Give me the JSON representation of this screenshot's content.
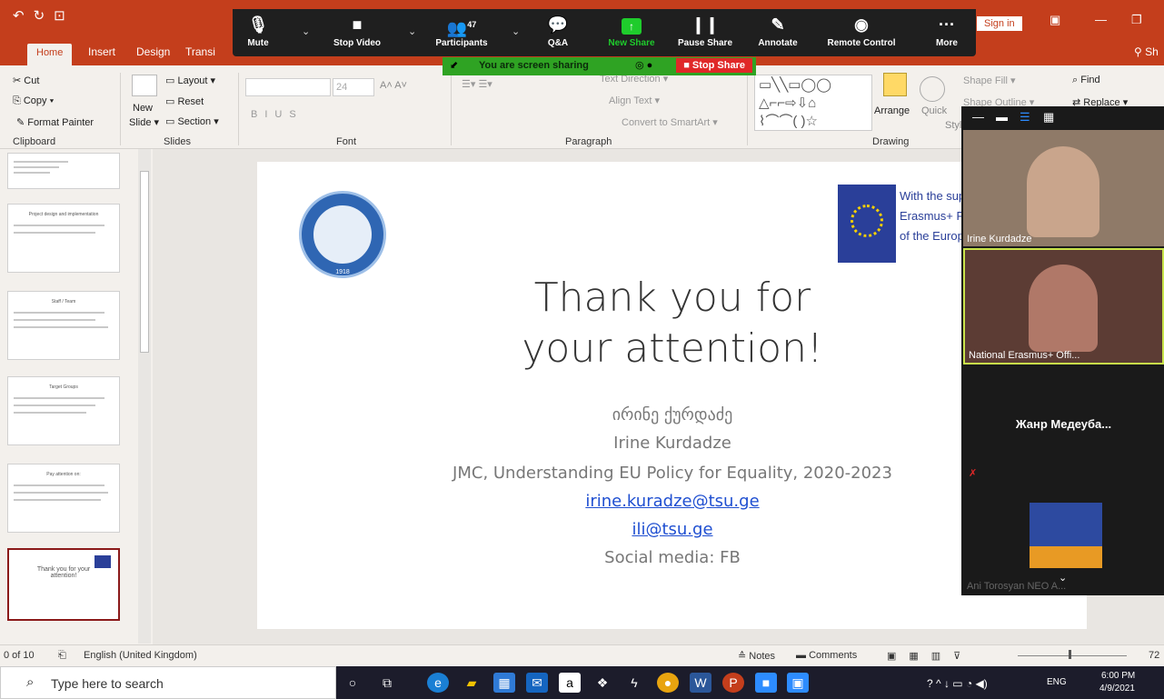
{
  "ribbon_tabs": [
    "Home",
    "Insert",
    "Design",
    "Transi"
  ],
  "title": {
    "sign_in": "Sign in",
    "share": "Sh"
  },
  "zoom_toolbar": {
    "mute": "Mute",
    "stop_video": "Stop Video",
    "participants": "Participants",
    "participants_count": "47",
    "qa": "Q&A",
    "new_share": "New Share",
    "pause_share": "Pause Share",
    "annotate": "Annotate",
    "remote_control": "Remote Control",
    "more": "More"
  },
  "share_bar": {
    "status": "You are screen sharing",
    "stop": "Stop Share"
  },
  "clipboard": {
    "cut": "Cut",
    "copy": "Copy",
    "format_painter": "Format Painter",
    "group": "Clipboard"
  },
  "slides_group": {
    "new_slide": "New",
    "new_slide2": "Slide",
    "layout": "Layout",
    "reset": "Reset",
    "section": "Section",
    "group": "Slides"
  },
  "font_group": {
    "size": "24",
    "group": "Font"
  },
  "paragraph_group": {
    "text_direction": "Text Direction",
    "align_text": "Align Text",
    "convert": "Convert to SmartArt",
    "group": "Paragraph"
  },
  "drawing_group": {
    "arrange": "Arrange",
    "quick": "Quick",
    "styles": "Styles",
    "shape_fill": "Shape Fill",
    "shape_outline": "Shape Outline",
    "group": "Drawing"
  },
  "editing_group": {
    "find": "Find",
    "replace": "Replace"
  },
  "thumbnails": [
    {
      "title": ""
    },
    {
      "title": "Project design and implementation"
    },
    {
      "title": "Staff / Team"
    },
    {
      "title": "Target Groups"
    },
    {
      "title": "Pay attention on:"
    },
    {
      "title": "Thank you for your attention!"
    }
  ],
  "slide": {
    "seal_year": "1918",
    "eu_text": [
      "With the sup",
      "Erasmus+ P",
      "of the Europ"
    ],
    "thanks_line1": "Thank you for",
    "thanks_line2": "your attention!",
    "name_georgian": "ირინე ქურდაძე",
    "name": "Irine Kurdadze",
    "project": "JMC, Understanding EU Policy for Equality,  2020-2023",
    "email1": "irine.kuradze@tsu.ge",
    "email2": "ili@tsu.ge",
    "social": "Social media: FB"
  },
  "video": {
    "p1": "Irine Kurdadze",
    "p2": "National Erasmus+ Offi...",
    "p3": "Жанр  Медеуба...",
    "p4": "Ani Torosyan NEO A..."
  },
  "status_bar": {
    "slide_count": "0 of 10",
    "language": "English (United Kingdom)",
    "notes": "Notes",
    "comments": "Comments",
    "zoom": "72"
  },
  "taskbar": {
    "search_placeholder": "Type here to search",
    "time": "6:00 PM",
    "date": "4/9/2021",
    "lang": "ENG"
  }
}
